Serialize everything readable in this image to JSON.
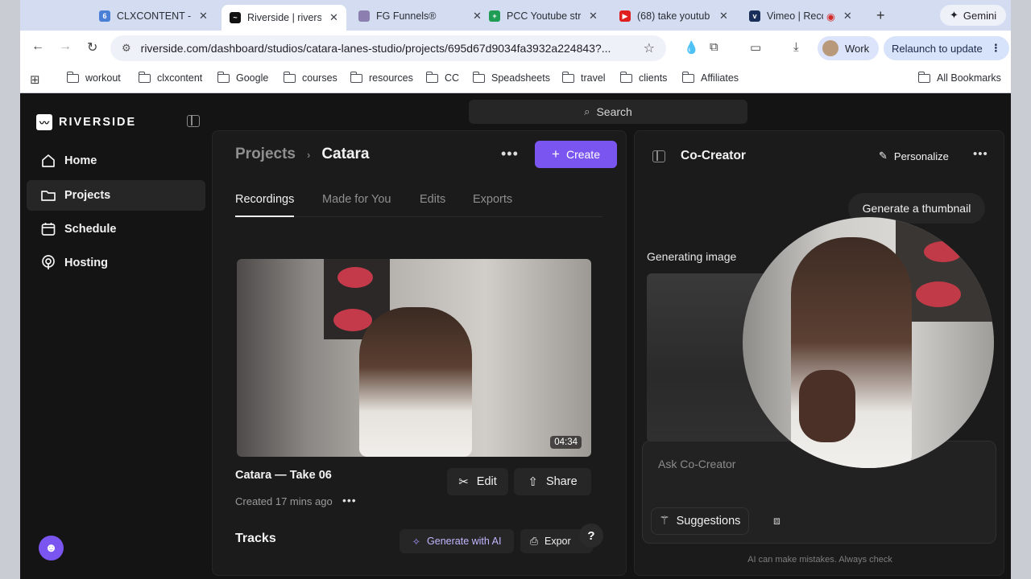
{
  "browser": {
    "tabs": [
      {
        "title": "CLXCONTENT - G",
        "fav_color": "#4a7fd8",
        "fav_glyph": "6"
      },
      {
        "title": "Riverside | riversi",
        "fav_color": "#111111",
        "fav_glyph": "~"
      },
      {
        "title": "FG Funnels®",
        "fav_color": "#8c7fb0",
        "fav_glyph": ""
      },
      {
        "title": "PCC Youtube str",
        "fav_color": "#1f9d55",
        "fav_glyph": "+"
      },
      {
        "title": "(68) take youtub",
        "fav_color": "#e02020",
        "fav_glyph": "▶"
      },
      {
        "title": "Vimeo | Reco",
        "fav_color": "#1a2e5a",
        "fav_glyph": "v"
      }
    ],
    "gemini_label": "Gemini",
    "url": "riverside.com/dashboard/studios/catara-lanes-studio/projects/695d67d9034fa3932a224843?...",
    "profile_label": "Work",
    "relaunch_label": "Relaunch to update",
    "bookmarks": [
      "workout",
      "clxcontent",
      "Google",
      "courses",
      "resources",
      "CC",
      "Speadsheets",
      "travel",
      "clients",
      "Affiliates"
    ],
    "all_bookmarks_label": "All Bookmarks"
  },
  "sidebar": {
    "brand": "RIVERSIDE",
    "items": [
      {
        "label": "Home",
        "icon": "home-icon"
      },
      {
        "label": "Projects",
        "icon": "folder-icon"
      },
      {
        "label": "Schedule",
        "icon": "calendar-icon"
      },
      {
        "label": "Hosting",
        "icon": "podcast-icon"
      }
    ],
    "active_item": "Projects"
  },
  "search": {
    "placeholder": "Search"
  },
  "project": {
    "breadcrumb_root": "Projects",
    "breadcrumb_current": "Catara",
    "create_label": "Create",
    "tabs": [
      "Recordings",
      "Made for You",
      "Edits",
      "Exports"
    ],
    "active_tab": "Recordings",
    "recording": {
      "title": "Catara — Take 06",
      "meta": "Created 17 mins ago",
      "duration": "04:34",
      "edit_label": "Edit",
      "share_label": "Share"
    },
    "tracks_label": "Tracks",
    "generate_ai_label": "Generate with AI",
    "export_label": "Expor",
    "help_label": "?"
  },
  "cocreator": {
    "title": "Co-Creator",
    "personalize_label": "Personalize",
    "chip_label": "Generate a thumbnail",
    "generating_label": "Generating image",
    "ask_placeholder": "Ask Co-Creator",
    "suggestions_label": "Suggestions",
    "disclaimer": "AI can make mistakes. Always check"
  },
  "colors": {
    "accent": "#7b55f0",
    "app_bg": "#141414",
    "panel_bg": "#1b1b1b"
  }
}
